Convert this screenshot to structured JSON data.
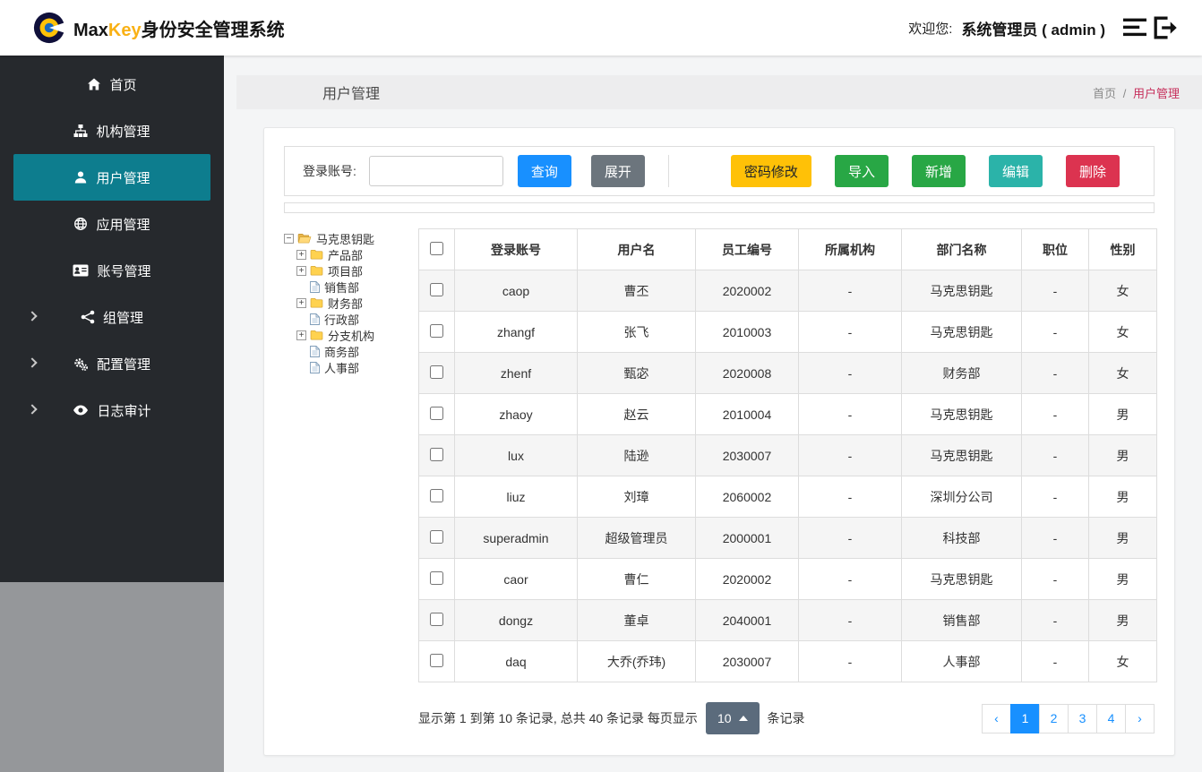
{
  "header": {
    "brand": {
      "max": "Max",
      "key": "Key",
      "suffix": "身份安全管理系统"
    },
    "welcome_label": "欢迎您:",
    "user_label": "系统管理员 ( admin )"
  },
  "sidebar": {
    "items": [
      {
        "label": "首页",
        "icon": "home-icon",
        "active": false,
        "group": false
      },
      {
        "label": "机构管理",
        "icon": "sitemap-icon",
        "active": false,
        "group": false
      },
      {
        "label": "用户管理",
        "icon": "user-icon",
        "active": true,
        "group": false
      },
      {
        "label": "应用管理",
        "icon": "globe-icon",
        "active": false,
        "group": false
      },
      {
        "label": "账号管理",
        "icon": "id-card-icon",
        "active": false,
        "group": false
      },
      {
        "label": "组管理",
        "icon": "group-icon",
        "active": false,
        "group": true
      },
      {
        "label": "配置管理",
        "icon": "gears-icon",
        "active": false,
        "group": true
      },
      {
        "label": "日志审计",
        "icon": "eye-icon",
        "active": false,
        "group": true
      }
    ]
  },
  "page": {
    "title": "用户管理",
    "breadcrumb": {
      "home": "首页",
      "separator": "/",
      "current": "用户管理"
    }
  },
  "toolbar": {
    "search_label": "登录账号:",
    "search_value": "",
    "query_button": "查询",
    "expand_button": "展开",
    "actions": [
      {
        "label": "密码修改",
        "color": "#ffc107"
      },
      {
        "label": "导入",
        "color": "#28a745"
      },
      {
        "label": "新增",
        "color": "#28a745"
      },
      {
        "label": "编辑",
        "color": "#2bb3a9"
      },
      {
        "label": "删除",
        "color": "#dc3350"
      }
    ]
  },
  "tree": {
    "root": {
      "label": "马克思钥匙"
    },
    "nodes": [
      {
        "label": "产品部",
        "type": "folder"
      },
      {
        "label": "项目部",
        "type": "folder"
      },
      {
        "label": "销售部",
        "type": "leaf"
      },
      {
        "label": "财务部",
        "type": "folder"
      },
      {
        "label": "行政部",
        "type": "leaf"
      },
      {
        "label": "分支机构",
        "type": "folder"
      },
      {
        "label": "商务部",
        "type": "leaf"
      },
      {
        "label": "人事部",
        "type": "leaf"
      }
    ]
  },
  "table": {
    "columns": [
      "登录账号",
      "用户名",
      "员工编号",
      "所属机构",
      "部门名称",
      "职位",
      "性别"
    ],
    "rows": [
      [
        "caop",
        "曹丕",
        "2020002",
        "-",
        "马克思钥匙",
        "-",
        "女"
      ],
      [
        "zhangf",
        "张飞",
        "2010003",
        "-",
        "马克思钥匙",
        "-",
        "女"
      ],
      [
        "zhenf",
        "甄宓",
        "2020008",
        "-",
        "财务部",
        "-",
        "女"
      ],
      [
        "zhaoy",
        "赵云",
        "2010004",
        "-",
        "马克思钥匙",
        "-",
        "男"
      ],
      [
        "lux",
        "陆逊",
        "2030007",
        "-",
        "马克思钥匙",
        "-",
        "男"
      ],
      [
        "liuz",
        "刘璋",
        "2060002",
        "-",
        "深圳分公司",
        "-",
        "男"
      ],
      [
        "superadmin",
        "超级管理员",
        "2000001",
        "-",
        "科技部",
        "-",
        "男"
      ],
      [
        "caor",
        "曹仁",
        "2020002",
        "-",
        "马克思钥匙",
        "-",
        "男"
      ],
      [
        "dongz",
        "董卓",
        "2040001",
        "-",
        "销售部",
        "-",
        "男"
      ],
      [
        "daq",
        "大乔(乔玮)",
        "2030007",
        "-",
        "人事部",
        "-",
        "女"
      ]
    ]
  },
  "pagination": {
    "summary_prefix": "显示第 1 到第 10 条记录, 总共 40 条记录 每页显示",
    "page_size": "10",
    "summary_suffix": "条记录",
    "prev": "‹",
    "next": "›",
    "pages": [
      "1",
      "2",
      "3",
      "4"
    ],
    "active_page": "1"
  },
  "colors": {
    "sidebar_bg": "#26292d",
    "sidebar_active": "#0d7d8e",
    "primary": "#1890ff",
    "breadcrumb_current": "#c7305c",
    "brand_key": "#f9b115",
    "warning": "#ffc107",
    "success": "#28a745",
    "teal": "#2bb3a9",
    "danger": "#dc3350"
  }
}
